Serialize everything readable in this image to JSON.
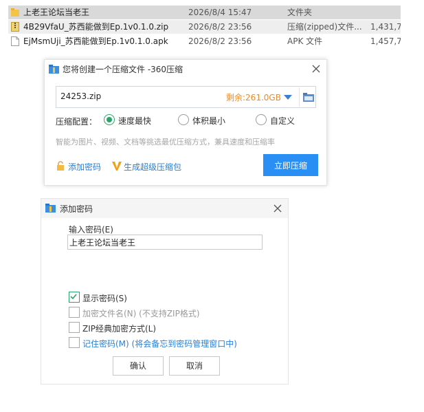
{
  "file_list": {
    "rows": [
      {
        "name": "上老王论坛当老王",
        "date": "2026/8/4 15:47",
        "type": "文件夹",
        "size": "",
        "icon": "folder-icon"
      },
      {
        "name": "4B29VfaU_苏西能做到Ep.1v0.1.0.zip",
        "date": "2026/8/2 23:56",
        "type": "压缩(zipped)文件...",
        "size": "1,431,7",
        "icon": "zip-file-icon"
      },
      {
        "name": "EjMsmUji_苏西能做到Ep.1v0.1.0.apk",
        "date": "2026/8/2 23:56",
        "type": "APK 文件",
        "size": "1,457,7",
        "icon": "file-icon"
      }
    ]
  },
  "compress_dialog": {
    "title": "您将创建一个压缩文件 -360压缩",
    "filename": "24253.zip",
    "space_remaining": "剩余:261.0GB",
    "config_label": "压缩配置：",
    "options": [
      "速度最快",
      "体积最小",
      "自定义"
    ],
    "selected_option": "速度最快",
    "hint": "智能为图片、视频、文档等挑选最优压缩方式，兼具速度和压缩率",
    "add_password": "添加密码",
    "super_zip": "生成超级压缩包",
    "compress_now": "立即压缩"
  },
  "password_dialog": {
    "title": "添加密码",
    "input_label": "输入密码(E)",
    "password_value": "上老王论坛当老王",
    "checkboxes": [
      {
        "label": "显示密码(S)",
        "checked": true,
        "disabled": false,
        "link": false
      },
      {
        "label": "加密文件名(N) (不支持ZIP格式)",
        "checked": false,
        "disabled": true,
        "link": false
      },
      {
        "label": "ZIP经典加密方式(L)",
        "checked": false,
        "disabled": false,
        "link": false
      },
      {
        "label": "记住密码(M) (将会备忘到密码管理窗口中)",
        "checked": false,
        "disabled": false,
        "link": true
      }
    ],
    "confirm": "确认",
    "cancel": "取消"
  },
  "colors": {
    "accent_blue": "#2a8ff5",
    "link_blue": "#2a7fd4",
    "check_green": "#2aa56a",
    "space_orange": "#f08a24"
  }
}
